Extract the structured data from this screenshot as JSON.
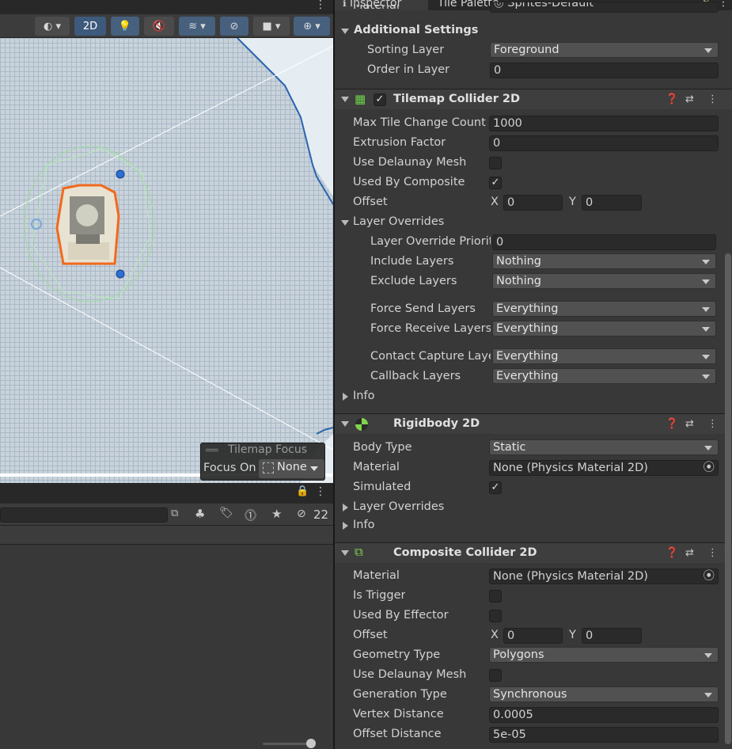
{
  "inspector_tabs": {
    "inspector": "Inspector",
    "tile_palette": "Tile Palette"
  },
  "scene": {
    "toolbar": {
      "mode_2d": "2D"
    },
    "focus": {
      "title": "Tilemap Focus",
      "focus_on_label": "Focus On",
      "focus_on_value": "None"
    },
    "hidden_count": "22"
  },
  "renderer": {
    "material_label": "Material",
    "material_value": "Sprites-Default",
    "additional_settings": "Additional Settings",
    "sorting_layer_label": "Sorting Layer",
    "sorting_layer_value": "Foreground",
    "order_in_layer_label": "Order in Layer",
    "order_in_layer_value": "0"
  },
  "tilemap_collider": {
    "title": "Tilemap Collider 2D",
    "max_tile_change_label": "Max Tile Change Count",
    "max_tile_change_value": "1000",
    "extrusion_label": "Extrusion Factor",
    "extrusion_value": "0",
    "delaunay_label": "Use Delaunay Mesh",
    "composite_label": "Used By Composite",
    "offset_label": "Offset",
    "offset_x": "0",
    "offset_y": "0",
    "layer_overrides": "Layer Overrides",
    "override_priority_label": "Layer Override Priorit",
    "override_priority_value": "0",
    "include_label": "Include Layers",
    "include_value": "Nothing",
    "exclude_label": "Exclude Layers",
    "exclude_value": "Nothing",
    "force_send_label": "Force Send Layers",
    "force_send_value": "Everything",
    "force_receive_label": "Force Receive Layers",
    "force_receive_value": "Everything",
    "contact_capture_label": "Contact Capture Layers",
    "contact_capture_value": "Everything",
    "callback_label": "Callback Layers",
    "callback_value": "Everything",
    "info": "Info"
  },
  "rigidbody": {
    "title": "Rigidbody 2D",
    "body_type_label": "Body Type",
    "body_type_value": "Static",
    "material_label": "Material",
    "material_value": "None (Physics Material 2D)",
    "simulated_label": "Simulated",
    "layer_overrides": "Layer Overrides",
    "info": "Info"
  },
  "composite": {
    "title": "Composite Collider 2D",
    "material_label": "Material",
    "material_value": "None (Physics Material 2D)",
    "is_trigger_label": "Is Trigger",
    "effector_label": "Used By Effector",
    "offset_label": "Offset",
    "offset_x": "0",
    "offset_y": "0",
    "geometry_label": "Geometry Type",
    "geometry_value": "Polygons",
    "delaunay_label": "Use Delaunay Mesh",
    "generation_label": "Generation Type",
    "generation_value": "Synchronous",
    "vertex_label": "Vertex Distance",
    "vertex_value": "0.0005",
    "offset_distance_label": "Offset Distance",
    "offset_distance_value": "5e-05"
  },
  "axis": {
    "x": "X",
    "y": "Y"
  },
  "checkmark": "✓"
}
